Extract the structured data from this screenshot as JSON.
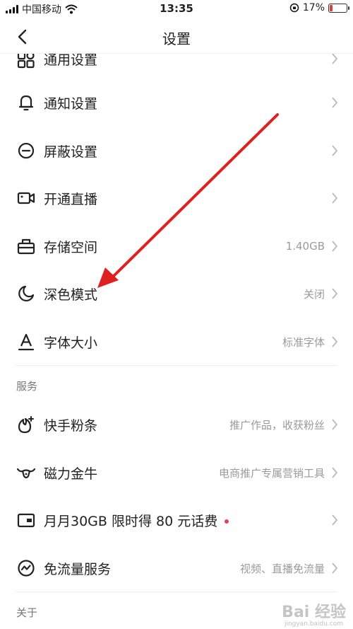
{
  "status_bar": {
    "carrier": "中国移动",
    "time": "13:35",
    "battery_percent": "17%",
    "battery_level": 0.17
  },
  "header": {
    "title": "设置"
  },
  "items": [
    {
      "label": "通用设置",
      "value": ""
    },
    {
      "label": "通知设置",
      "value": ""
    },
    {
      "label": "屏蔽设置",
      "value": ""
    },
    {
      "label": "开通直播",
      "value": ""
    },
    {
      "label": "存储空间",
      "value": "1.40GB"
    },
    {
      "label": "深色模式",
      "value": "关闭"
    },
    {
      "label": "字体大小",
      "value": "标准字体"
    }
  ],
  "services": {
    "header": "服务",
    "items": [
      {
        "label": "快手粉条",
        "value": "推广作品，收获粉丝"
      },
      {
        "label": "磁力金牛",
        "value": "电商推广专属营销工具"
      },
      {
        "label": "月月30GB 限时得 80 元话费",
        "value": ""
      },
      {
        "label": "免流量服务",
        "value": "视频、直播免流量"
      }
    ]
  },
  "about": {
    "header": "关于"
  },
  "watermark": {
    "text": "Bai 经验",
    "sub": "jingyan.baidu.com"
  },
  "colors": {
    "annotation_arrow": "#e02020",
    "red_dot": "#e8415a"
  }
}
